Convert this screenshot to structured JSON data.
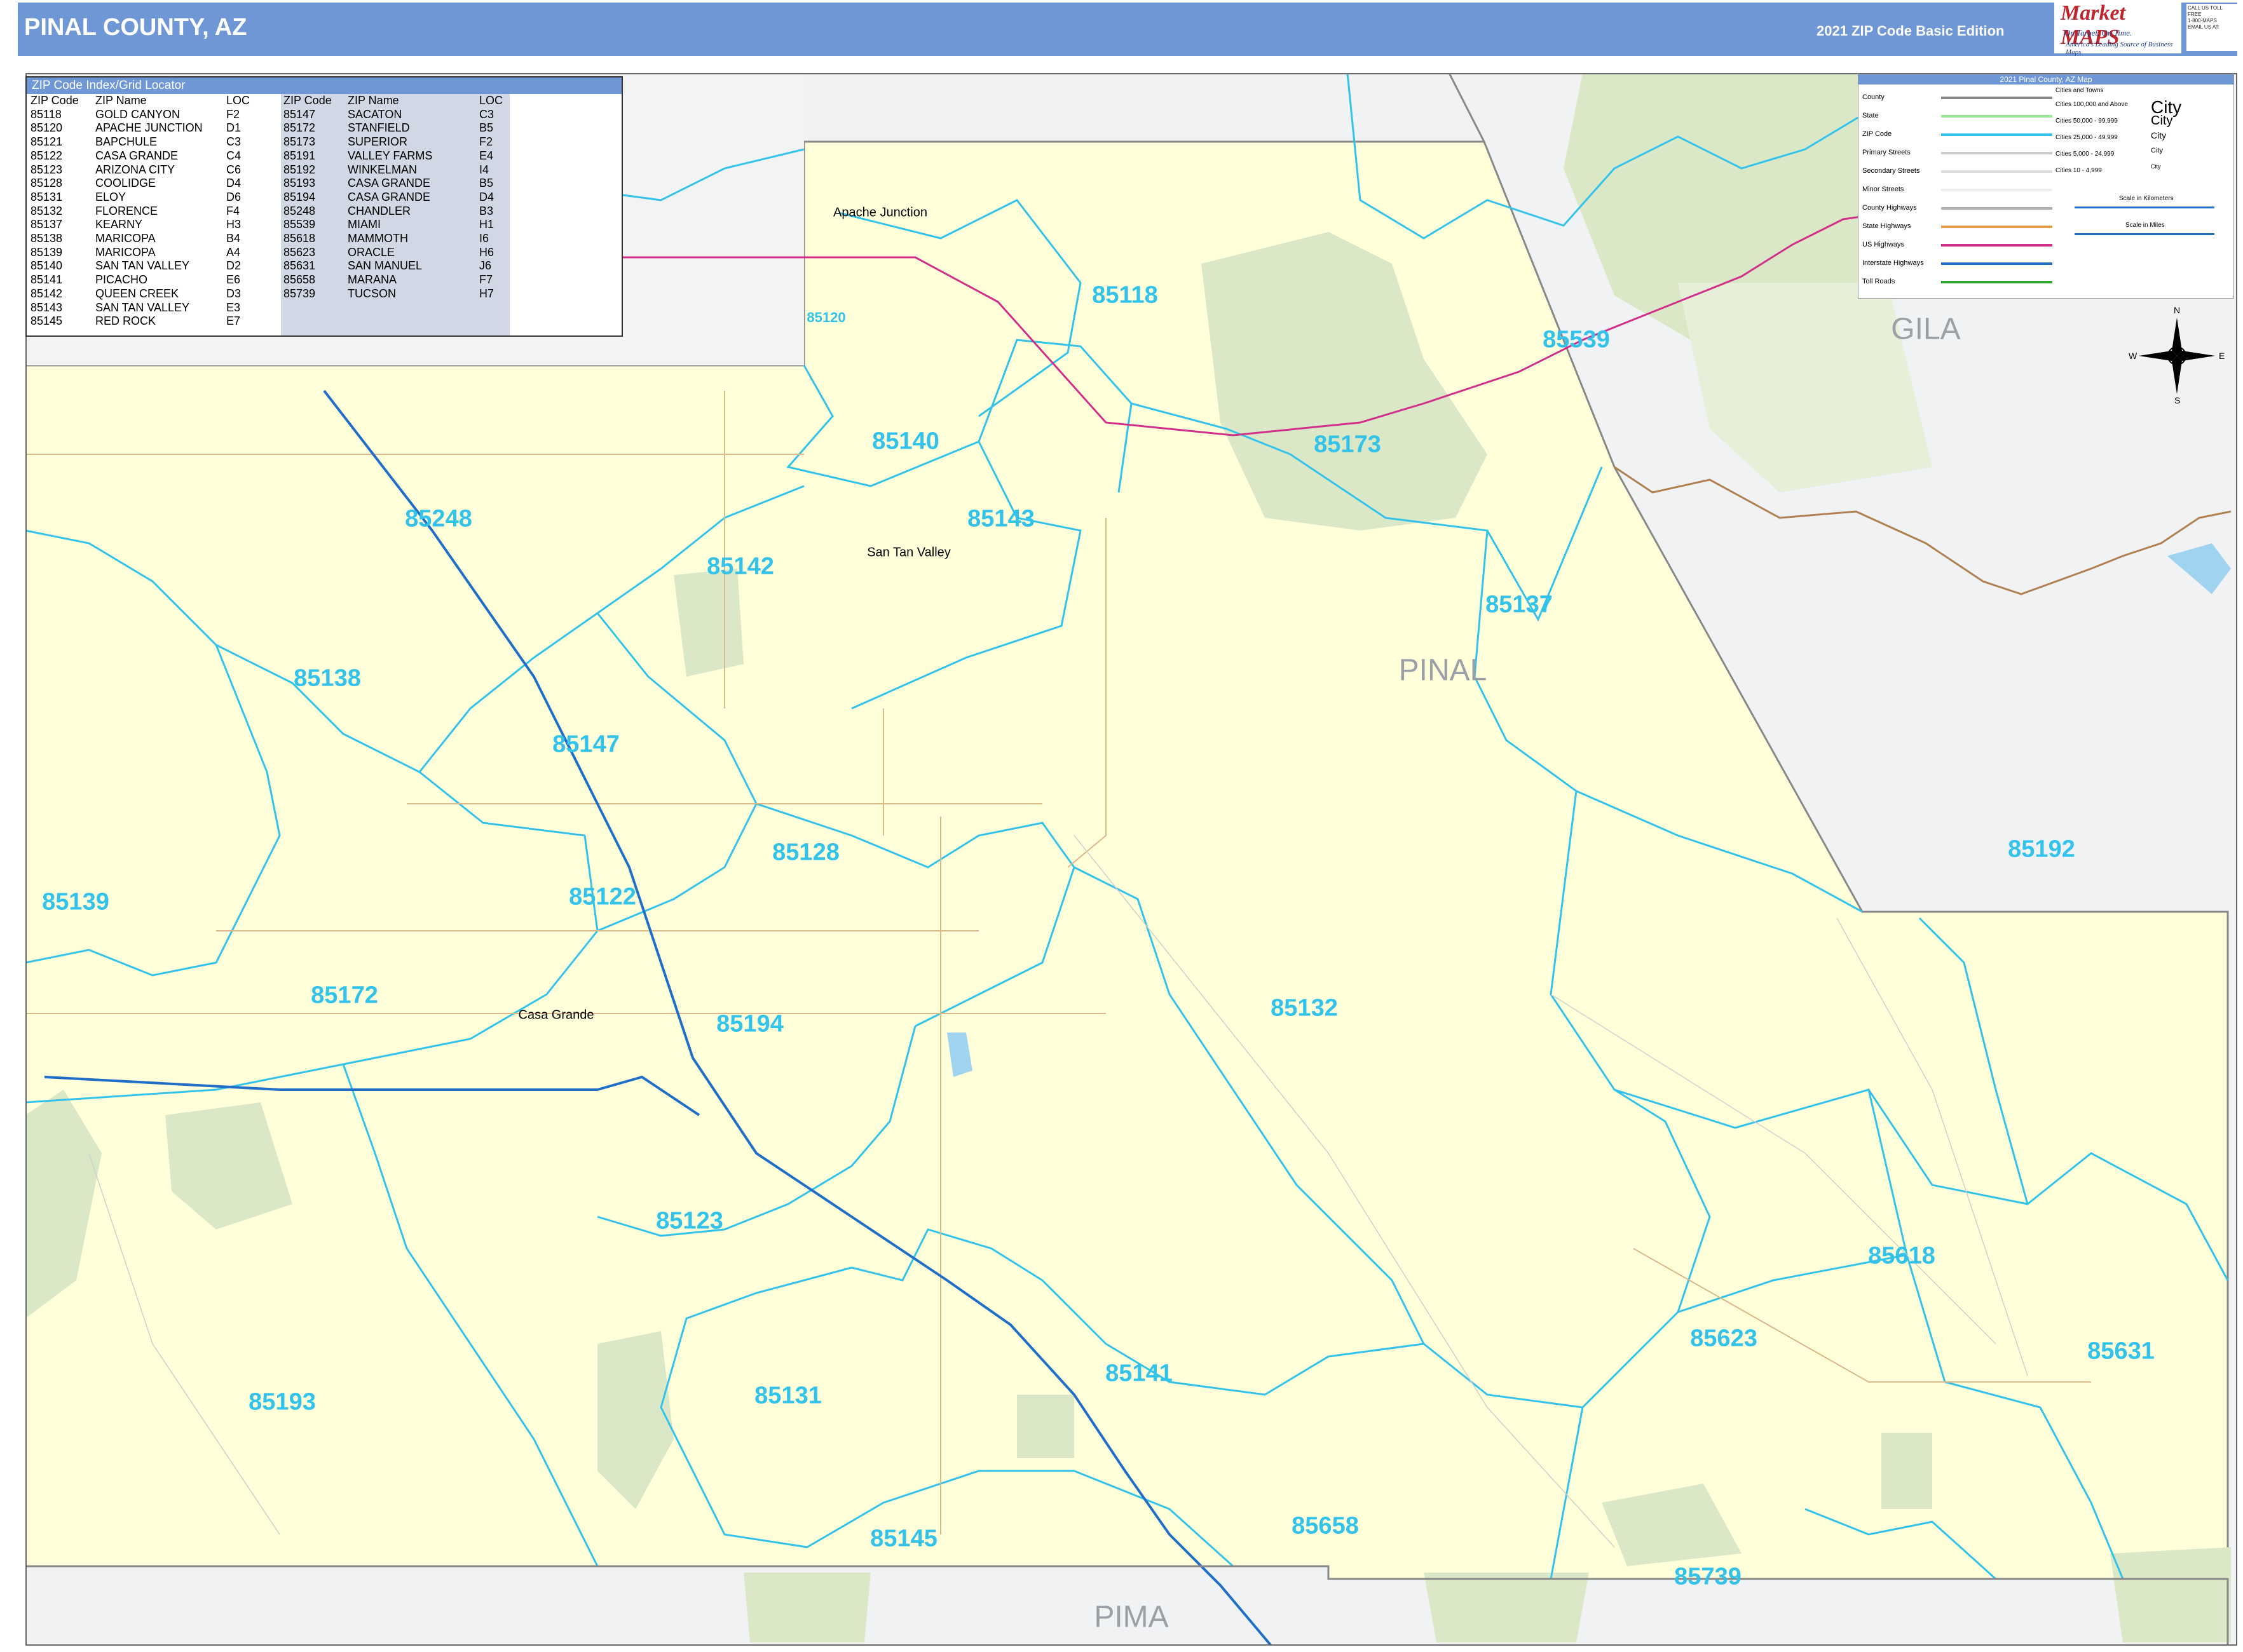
{
  "header": {
    "title": "PINAL COUNTY, AZ",
    "edition": "2021 ZIP Code Basic Edition",
    "logo_brand": "Market MAPS",
    "logo_slogan": "On Target, On Time.",
    "logo_tagline": "America's Leading Source of Business Maps",
    "contact_lines": [
      "CALL US TOLL FREE",
      "1-800-MAPS",
      "EMAIL US AT:"
    ]
  },
  "index": {
    "title": "ZIP Code Index/Grid Locator",
    "headers": {
      "zip": "ZIP Code",
      "name": "ZIP Name",
      "loc": "LOC"
    },
    "left": [
      [
        "85118",
        "GOLD CANYON",
        "F2"
      ],
      [
        "85120",
        "APACHE JUNCTION",
        "D1"
      ],
      [
        "85121",
        "BAPCHULE",
        "C3"
      ],
      [
        "85122",
        "CASA GRANDE",
        "C4"
      ],
      [
        "85123",
        "ARIZONA CITY",
        "C6"
      ],
      [
        "85128",
        "COOLIDGE",
        "D4"
      ],
      [
        "85131",
        "ELOY",
        "D6"
      ],
      [
        "85132",
        "FLORENCE",
        "F4"
      ],
      [
        "85137",
        "KEARNY",
        "H3"
      ],
      [
        "85138",
        "MARICOPA",
        "B4"
      ],
      [
        "85139",
        "MARICOPA",
        "A4"
      ],
      [
        "85140",
        "SAN TAN VALLEY",
        "D2"
      ],
      [
        "85141",
        "PICACHO",
        "E6"
      ],
      [
        "85142",
        "QUEEN CREEK",
        "D3"
      ],
      [
        "85143",
        "SAN TAN VALLEY",
        "E3"
      ],
      [
        "85145",
        "RED ROCK",
        "E7"
      ]
    ],
    "right": [
      [
        "85147",
        "SACATON",
        "C3"
      ],
      [
        "85172",
        "STANFIELD",
        "B5"
      ],
      [
        "85173",
        "SUPERIOR",
        "F2"
      ],
      [
        "85191",
        "VALLEY FARMS",
        "E4"
      ],
      [
        "85192",
        "WINKELMAN",
        "I4"
      ],
      [
        "85193",
        "CASA GRANDE",
        "B5"
      ],
      [
        "85194",
        "CASA GRANDE",
        "D4"
      ],
      [
        "85248",
        "CHANDLER",
        "B3"
      ],
      [
        "85539",
        "MIAMI",
        "H1"
      ],
      [
        "85618",
        "MAMMOTH",
        "I6"
      ],
      [
        "85623",
        "ORACLE",
        "H6"
      ],
      [
        "85631",
        "SAN MANUEL",
        "J6"
      ],
      [
        "85658",
        "MARANA",
        "F7"
      ],
      [
        "85739",
        "TUCSON",
        "H7"
      ]
    ]
  },
  "legend": {
    "title": "2021 Pinal County, AZ Map",
    "items": [
      {
        "label": "County",
        "color": "#888888"
      },
      {
        "label": "State",
        "color": "#9be89b"
      },
      {
        "label": "ZIP Code",
        "color": "#33c3ea"
      },
      {
        "label": "Primary Streets",
        "color": "#cccccc"
      },
      {
        "label": "Secondary Streets",
        "color": "#dddddd"
      },
      {
        "label": "Minor Streets",
        "color": "#eeeeee"
      },
      {
        "label": "County Highways",
        "color": "#b0b0b0"
      },
      {
        "label": "State Highways",
        "color": "#e8a050"
      },
      {
        "label": "US Highways",
        "color": "#d0308a"
      },
      {
        "label": "Interstate Highways",
        "color": "#1f6fc8"
      },
      {
        "label": "Toll Roads",
        "color": "#2ea82e"
      }
    ],
    "cities_header": "Cities and Towns",
    "cities": [
      {
        "label": "Cities 100,000 and Above",
        "sample": "City"
      },
      {
        "label": "Cities 50,000 - 99,999",
        "sample": "City"
      },
      {
        "label": "Cities 25,000 - 49,999",
        "sample": "City"
      },
      {
        "label": "Cities 5,000 - 24,999",
        "sample": "City"
      },
      {
        "label": "Cities 10 - 4,999",
        "sample": "City"
      }
    ],
    "scale_km": "Scale in Kilometers",
    "scale_mi": "Scale in Miles"
  },
  "compass": {
    "n": "N",
    "s": "S",
    "e": "E",
    "w": "W"
  },
  "counties": [
    {
      "name": "PINAL"
    },
    {
      "name": "GILA"
    },
    {
      "name": "PIMA"
    }
  ],
  "cities": [
    {
      "name": "San Tan Valley"
    },
    {
      "name": "Casa Grande"
    },
    {
      "name": "Apache Junction"
    }
  ],
  "zips": [
    {
      "code": "85118"
    },
    {
      "code": "85120"
    },
    {
      "code": "85539"
    },
    {
      "code": "85140"
    },
    {
      "code": "85173"
    },
    {
      "code": "85248"
    },
    {
      "code": "85143"
    },
    {
      "code": "85142"
    },
    {
      "code": "85137"
    },
    {
      "code": "85138"
    },
    {
      "code": "85147"
    },
    {
      "code": "85128"
    },
    {
      "code": "85192"
    },
    {
      "code": "85139"
    },
    {
      "code": "85122"
    },
    {
      "code": "85172"
    },
    {
      "code": "85194"
    },
    {
      "code": "85132"
    },
    {
      "code": "85123"
    },
    {
      "code": "85618"
    },
    {
      "code": "85623"
    },
    {
      "code": "85631"
    },
    {
      "code": "85141"
    },
    {
      "code": "85193"
    },
    {
      "code": "85131"
    },
    {
      "code": "85145"
    },
    {
      "code": "85658"
    },
    {
      "code": "85739"
    }
  ]
}
